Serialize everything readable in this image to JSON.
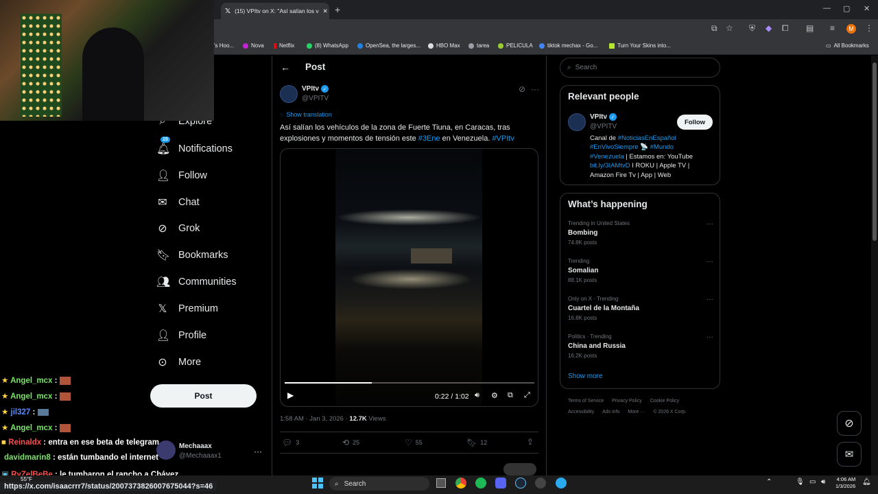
{
  "browser": {
    "tab_title": "(15) VPItv on X: \"Así salían los v",
    "new_tab": "+",
    "window_controls": [
      "—",
      "▢",
      "✕"
    ],
    "bookmarks": [
      {
        "label": "'s Hoo..."
      },
      {
        "label": "Nova"
      },
      {
        "label": "Netflix"
      },
      {
        "label": "(8) WhatsApp"
      },
      {
        "label": "OpenSea, the larges..."
      },
      {
        "label": "HBO Max"
      },
      {
        "label": "tarea"
      },
      {
        "label": "PELICULA"
      },
      {
        "label": "tiktok mechax - Go..."
      },
      {
        "label": "Turn Your Skins into..."
      }
    ],
    "all_bookmarks": "All Bookmarks",
    "profile_initial": "M"
  },
  "nav": {
    "items": [
      {
        "label": "Explore",
        "icon": "search-icon"
      },
      {
        "label": "Notifications",
        "icon": "bell-icon",
        "badge": "15"
      },
      {
        "label": "Follow",
        "icon": "add-user-icon"
      },
      {
        "label": "Chat",
        "icon": "mail-icon"
      },
      {
        "label": "Grok",
        "icon": "grok-icon"
      },
      {
        "label": "Bookmarks",
        "icon": "bookmark-icon"
      },
      {
        "label": "Communities",
        "icon": "communities-icon"
      },
      {
        "label": "Premium",
        "icon": "x-logo-icon"
      },
      {
        "label": "Profile",
        "icon": "person-icon"
      },
      {
        "label": "More",
        "icon": "more-circle-icon"
      }
    ],
    "post_button": "Post",
    "account": {
      "name": "Mechaaax",
      "handle": "@Mechaaax1",
      "more": "···"
    }
  },
  "post": {
    "header": "Post",
    "author_name": "VPItv",
    "author_handle": "@VPITV",
    "show_translation": "Show translation",
    "text_1": "Así salían los vehículos de la zona de Fuerte Tiuna, en Caracas, tras",
    "text_2a": "explosiones y momentos de tensión este ",
    "hashtag_1": "#3Ene",
    "text_2b": " en Venezuela. ",
    "hashtag_2": "#VPItv",
    "video_time": "0:22 / 1:02",
    "video_progress": 0.35,
    "timestamp": "1:58 AM · Jan 3, 2026 · ",
    "views_count": "12.7K",
    "views_label": " Views",
    "stats": {
      "replies": "3",
      "reposts": "25",
      "likes": "55",
      "bookmarks": "12"
    }
  },
  "sidebar": {
    "search_placeholder": "Search",
    "relevant_title": "Relevant people",
    "person": {
      "name": "VPItv",
      "handle": "@VPITV",
      "follow": "Follow",
      "bio_l1a": "Canal de ",
      "bio_l1b": "#NoticiasEnEspañol",
      "bio_l2a": "#EnVivoSiempre",
      "bio_l2b": " 📡 ",
      "bio_l2c": "#Mundo",
      "bio_l3a": "#Venezuela",
      "bio_l3b": " | Estamos en: YouTube",
      "bio_l4a": "bit.ly/3IAMtvD",
      "bio_l4b": " I ROKU | Apple TV |",
      "bio_l5": "Amazon Fire Tv | App | Web"
    },
    "happening_title": "What’s happening",
    "trends": [
      {
        "meta": "Trending in United States",
        "name": "Bombing",
        "posts": "74.8K posts"
      },
      {
        "meta": "Trending",
        "name": "Somalian",
        "posts": "88.1K posts"
      },
      {
        "meta": "Only on X · Trending",
        "name": "Cuartel de la Montaña",
        "posts": "16.8K posts"
      },
      {
        "meta": "Politics · Trending",
        "name": "China and Russia",
        "posts": "16.2K posts"
      }
    ],
    "show_more": "Show more",
    "footer_1": [
      "Terms of Service",
      "Privacy Policy",
      "Cookie Policy"
    ],
    "footer_2": [
      "Accessibility",
      "Ads info",
      "More ···",
      "© 2026 X Corp."
    ]
  },
  "chat": [
    {
      "user": "Angel_mcx",
      "msg": " : ",
      "color": "#7be36a"
    },
    {
      "user": "Angel_mcx",
      "msg": " : ",
      "color": "#7be36a"
    },
    {
      "user": "jil327",
      "msg": " : ",
      "color": "#5b8cff"
    },
    {
      "user": "Angel_mcx",
      "msg": " : ",
      "color": "#7be36a"
    },
    {
      "user": "Reinaldx",
      "msg": " : entra en ese beta de telegram",
      "color": "#ff4d4d"
    },
    {
      "user": "davidmarin8",
      "msg": " : están tumbando el internet",
      "color": "#7be36a"
    },
    {
      "user": "RyZelBeBe",
      "msg": " : le tumbaron el rancho a Chávez",
      "color": "#ff4d4d"
    }
  ],
  "status_url": "https://x.com/isaacrrr7/status/2007373826007675044?s=46",
  "taskbar": {
    "weather": "55°F",
    "search": "Search",
    "time": "4:06 AM",
    "date": "1/3/2026"
  }
}
